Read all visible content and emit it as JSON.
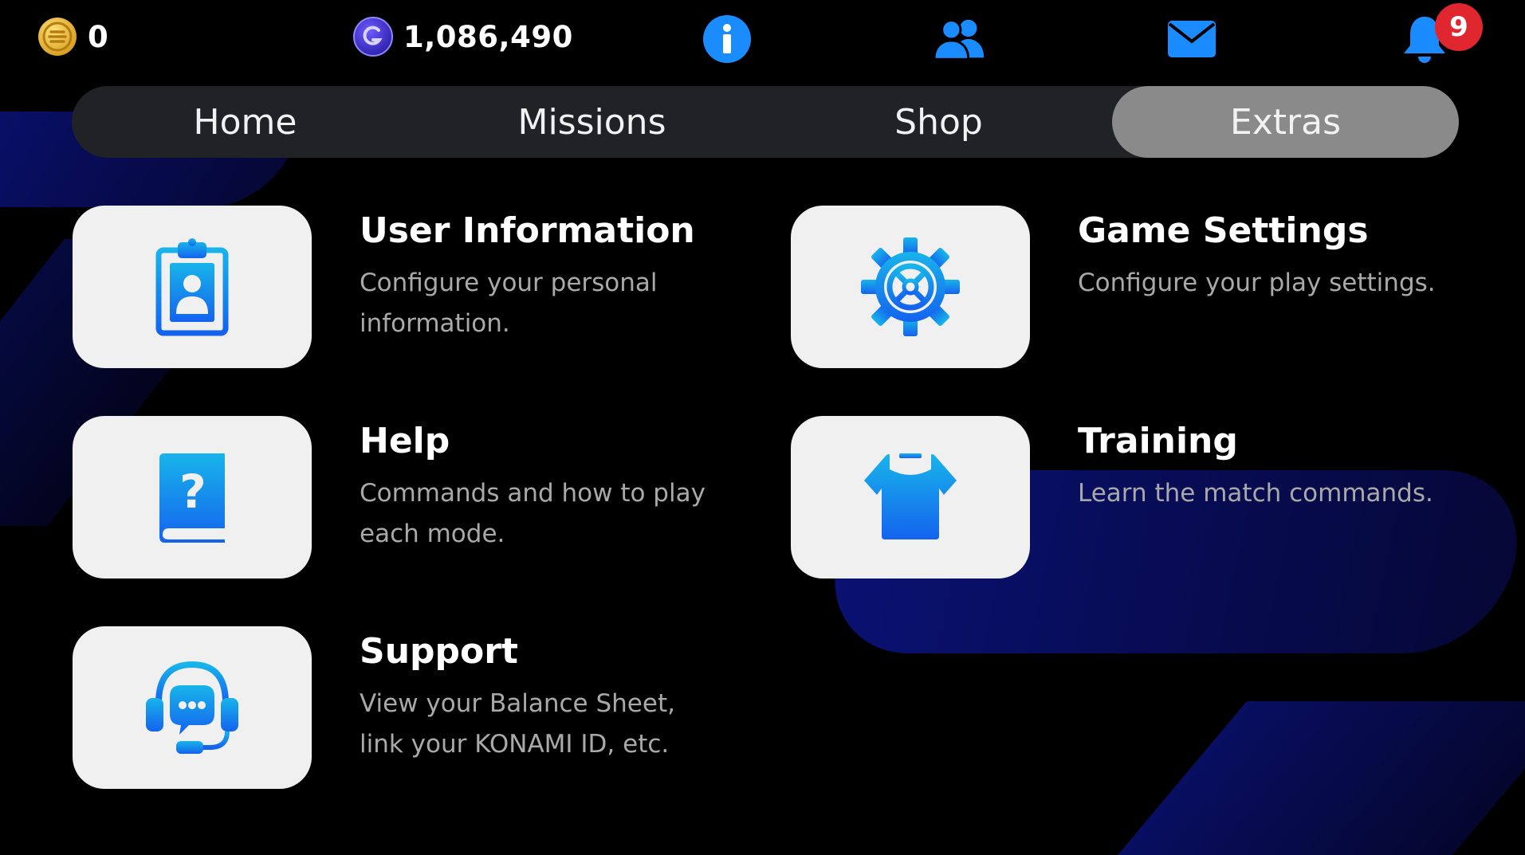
{
  "topbar": {
    "coins_value": "0",
    "gp_value": "1,086,490",
    "notification_count": "9"
  },
  "tabs": [
    {
      "label": "Home"
    },
    {
      "label": "Missions"
    },
    {
      "label": "Shop"
    },
    {
      "label": "Extras",
      "active": true
    }
  ],
  "menu": [
    {
      "title": "User Information",
      "description": "Configure your personal information.",
      "icon": "id-badge-icon"
    },
    {
      "title": "Game Settings",
      "description": "Configure your play settings.",
      "icon": "gear-icon"
    },
    {
      "title": "Help",
      "description": "Commands and how to play each mode.",
      "icon": "help-book-icon"
    },
    {
      "title": "Training",
      "description": "Learn the match commands.",
      "icon": "training-shirt-icon"
    },
    {
      "title": "Support",
      "description": "View your Balance Sheet, link your KONAMI ID, etc.",
      "icon": "headset-chat-icon"
    }
  ],
  "colors": {
    "accent_blue": "#1a8cff",
    "active_tab": "#8a8a8a",
    "tab_bar": "#202226",
    "badge_red": "#e0262e",
    "tile_bg": "#f0f0f0",
    "description_text": "#a9a9a9"
  }
}
